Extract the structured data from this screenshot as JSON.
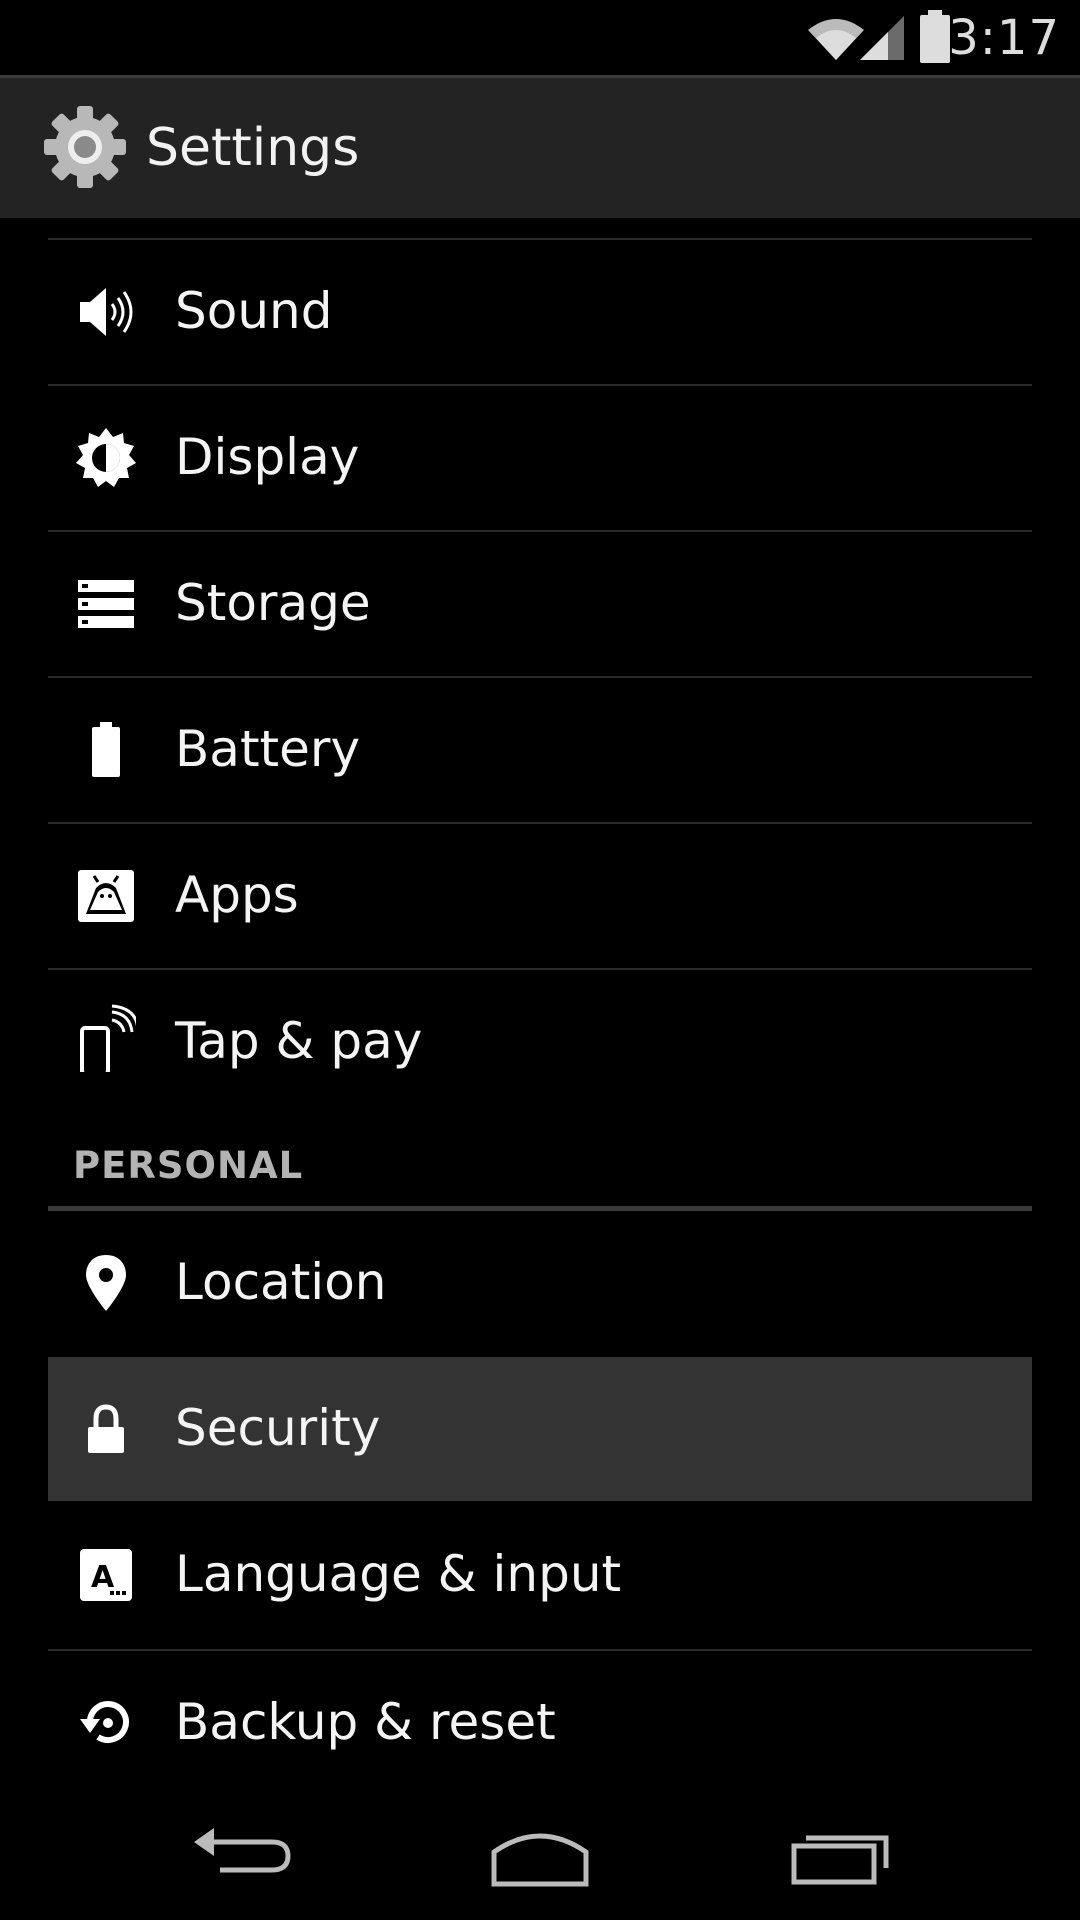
{
  "status_bar": {
    "time": "3:17",
    "icons": [
      "wifi-icon",
      "signal-icon",
      "battery-icon"
    ]
  },
  "action_bar": {
    "icon": "gear-icon",
    "title": "Settings"
  },
  "device_items": [
    {
      "label": "Sound",
      "icon": "speaker-icon"
    },
    {
      "label": "Display",
      "icon": "brightness-icon"
    },
    {
      "label": "Storage",
      "icon": "storage-icon"
    },
    {
      "label": "Battery",
      "icon": "battery-icon"
    },
    {
      "label": "Apps",
      "icon": "android-apps-icon"
    },
    {
      "label": "Tap & pay",
      "icon": "nfc-phone-icon"
    }
  ],
  "personal_section": {
    "header": "PERSONAL",
    "items": [
      {
        "label": "Location",
        "icon": "location-pin-icon"
      },
      {
        "label": "Security",
        "icon": "lock-icon",
        "selected": true
      },
      {
        "label": "Language & input",
        "icon": "keyboard-letter-icon"
      },
      {
        "label": "Backup & reset",
        "icon": "restore-icon"
      }
    ]
  },
  "nav_bar": {
    "buttons": [
      "back-icon",
      "home-icon",
      "recents-icon"
    ]
  },
  "colors": {
    "background": "#000000",
    "action_bar": "#232323",
    "selected_row": "#333333",
    "divider": "#2a2a2a",
    "section_text": "#b3b3b3"
  }
}
